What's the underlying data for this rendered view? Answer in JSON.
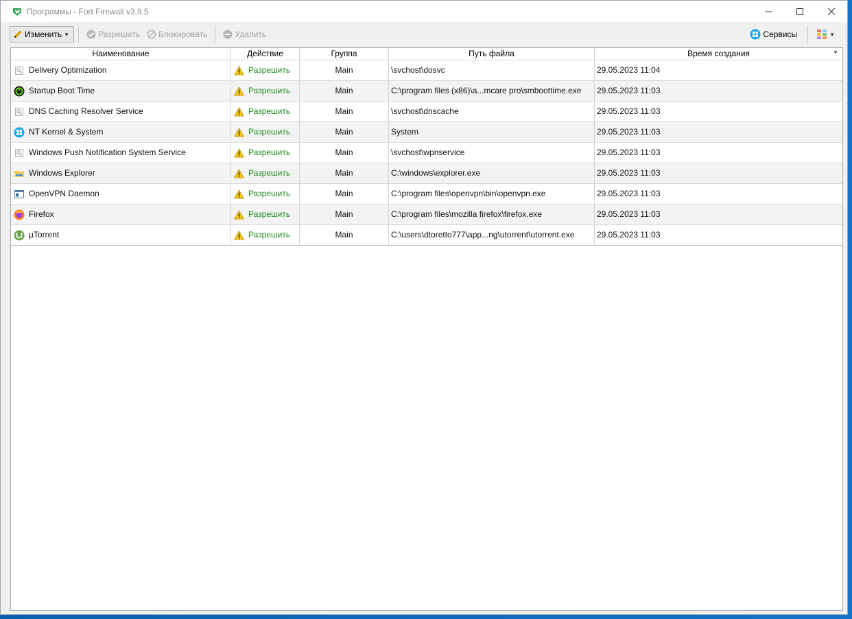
{
  "window": {
    "title": "Программы - Fort Firewall v3.9.5",
    "controls": {
      "minimize": "—",
      "maximize": "☐",
      "close": "✕"
    }
  },
  "toolbar": {
    "edit_label": "Изменить",
    "allow_label": "Разрешить",
    "block_label": "Блокировать",
    "delete_label": "Удалить",
    "services_label": "Сервисы"
  },
  "table": {
    "columns": [
      "Наименование",
      "Действие",
      "Группа",
      "Путь файла",
      "Время создания"
    ],
    "rows": [
      {
        "icon": "service-icon",
        "name": "Delivery Optimization",
        "action": "Разрешить",
        "group": "Main",
        "path": "\\svchost\\dosvc",
        "time": "29.05.2023 11:04"
      },
      {
        "icon": "boottime-icon",
        "name": "Startup Boot Time",
        "action": "Разрешить",
        "group": "Main",
        "path": "C:\\program files (x86)\\a...mcare pro\\smboottime.exe",
        "time": "29.05.2023 11:03"
      },
      {
        "icon": "service-icon",
        "name": "DNS Caching Resolver Service",
        "action": "Разрешить",
        "group": "Main",
        "path": "\\svchost\\dnscache",
        "time": "29.05.2023 11:03"
      },
      {
        "icon": "windows-icon",
        "name": "NT Kernel & System",
        "action": "Разрешить",
        "group": "Main",
        "path": "System",
        "time": "29.05.2023 11:03"
      },
      {
        "icon": "service-icon",
        "name": "Windows Push Notification System Service",
        "action": "Разрешить",
        "group": "Main",
        "path": "\\svchost\\wpnservice",
        "time": "29.05.2023 11:03"
      },
      {
        "icon": "folder-icon",
        "name": "Windows Explorer",
        "action": "Разрешить",
        "group": "Main",
        "path": "C:\\windows\\explorer.exe",
        "time": "29.05.2023 11:03"
      },
      {
        "icon": "app-window-icon",
        "name": "OpenVPN Daemon",
        "action": "Разрешить",
        "group": "Main",
        "path": "C:\\program files\\openvpn\\bin\\openvpn.exe",
        "time": "29.05.2023 11:03"
      },
      {
        "icon": "firefox-icon",
        "name": "Firefox",
        "action": "Разрешить",
        "group": "Main",
        "path": "C:\\program files\\mozilla firefox\\firefox.exe",
        "time": "29.05.2023 11:03"
      },
      {
        "icon": "utorrent-icon",
        "name": "µTorrent",
        "action": "Разрешить",
        "group": "Main",
        "path": "C:\\users\\dtoretto777\\app...ng\\utorrent\\utorrent.exe",
        "time": "29.05.2023 11:03"
      }
    ]
  },
  "colors": {
    "allow_text": "#1a8a1a",
    "desktop": "#0a5fb0",
    "services_icon": "#1aa3e8"
  }
}
